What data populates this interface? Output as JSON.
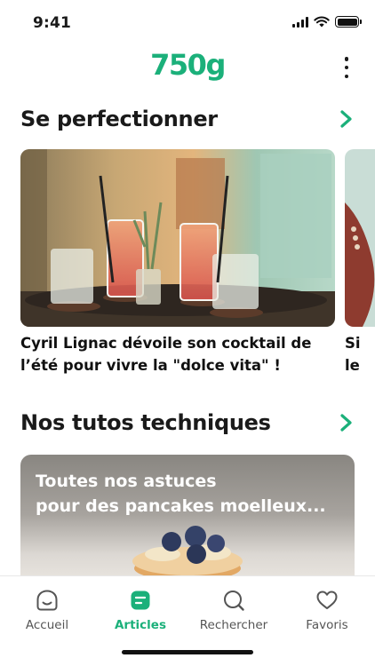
{
  "status_bar": {
    "time": "9:41"
  },
  "header": {
    "logo": "750g"
  },
  "sections": [
    {
      "title": "Se perfectionner",
      "cards": [
        {
          "title": "Cyril Lignac dévoile son cocktail de l’été pour vivre la \"dolce vita\" !"
        },
        {
          "title": "Si le ces"
        }
      ]
    },
    {
      "title": "Nos tutos techniques",
      "cards": [
        {
          "title": "Toutes nos astuces\npour des pancakes moelleux..."
        }
      ]
    }
  ],
  "bottom_nav": {
    "items": [
      {
        "label": "Accueil",
        "icon": "home-icon",
        "active": false
      },
      {
        "label": "Articles",
        "icon": "articles-icon",
        "active": true
      },
      {
        "label": "Rechercher",
        "icon": "search-icon",
        "active": false
      },
      {
        "label": "Favoris",
        "icon": "heart-icon",
        "active": false
      }
    ]
  },
  "colors": {
    "brand": "#1bb07a",
    "text": "#1a1a1a",
    "inactive": "#555555"
  }
}
